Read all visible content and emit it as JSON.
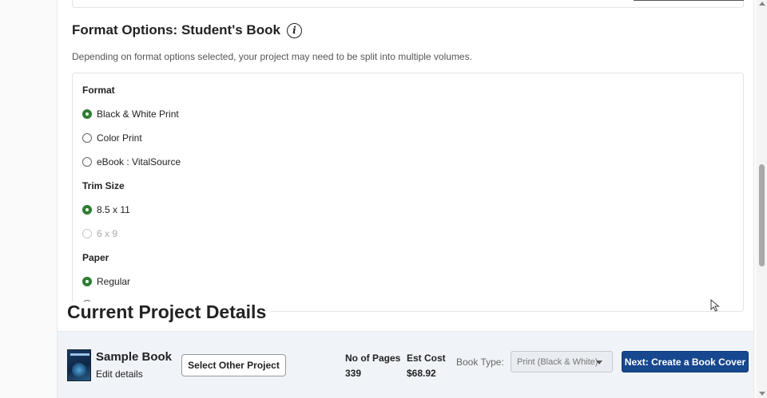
{
  "format_options": {
    "title": "Format Options: Student's Book",
    "info_icon": "info-icon",
    "subtitle": "Depending on format options selected, your project may need to be split into multiple volumes.",
    "groups": {
      "format": {
        "label": "Format",
        "options": [
          {
            "label": "Black & White Print",
            "selected": true,
            "disabled": false
          },
          {
            "label": "Color Print",
            "selected": false,
            "disabled": false
          },
          {
            "label": "eBook : VitalSource",
            "selected": false,
            "disabled": false
          }
        ]
      },
      "trim_size": {
        "label": "Trim Size",
        "options": [
          {
            "label": "8.5 x 11",
            "selected": true,
            "disabled": false
          },
          {
            "label": "6 x 9",
            "selected": false,
            "disabled": true
          }
        ]
      },
      "paper": {
        "label": "Paper",
        "options": [
          {
            "label": "Regular",
            "selected": true,
            "disabled": false
          }
        ]
      }
    }
  },
  "current_project": {
    "title": "Current Project Details",
    "book_name": "Sample Book",
    "edit_link": "Edit details",
    "select_other_label": "Select Other Project",
    "pages_label": "No of Pages",
    "pages_value": "339",
    "cost_label": "Est Cost",
    "cost_value": "$68.92",
    "book_type_label": "Book Type:",
    "book_type_value": "Print (Black & White)",
    "next_label": "Next: Create a Book Cover"
  },
  "colors": {
    "accent_green": "#2e7d32",
    "primary_blue": "#17488f",
    "bar_bg": "#f0f3f8"
  },
  "scrollbar": {
    "scroll_position": 0.42
  }
}
